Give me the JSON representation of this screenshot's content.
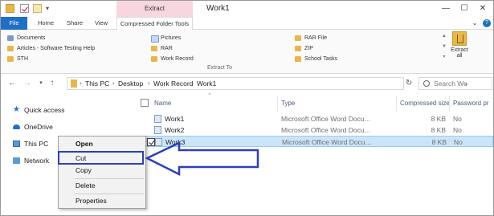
{
  "window": {
    "title": "Work1",
    "contextual_tab_label": "Extract",
    "minimize": "—",
    "maximize": "☐",
    "close": "✕"
  },
  "ribbon": {
    "tabs": [
      "File",
      "Home",
      "Share",
      "View",
      "Compressed Folder Tools"
    ],
    "destinations": [
      "Documents",
      "Articles - Software Testing Help",
      "STH",
      "Pictures",
      "RAR",
      "Work Record",
      "RAR File",
      "ZIP",
      "School Tasks"
    ],
    "group_label": "Extract To",
    "extract_all_label": "Extract all"
  },
  "address_bar": {
    "breadcrumbs": [
      "This PC",
      "Desktop",
      "Work Record",
      "Work1"
    ],
    "search_placeholder": "Search Wo"
  },
  "nav_pane": {
    "items": [
      "Quick access",
      "OneDrive",
      "This PC",
      "Network"
    ]
  },
  "columns": {
    "name": "Name",
    "type": "Type",
    "compressed_size": "Compressed size",
    "password": "Password pr"
  },
  "files": [
    {
      "name": "Work1",
      "type": "Microsoft Office Word Docu...",
      "size": "8 KB",
      "password": "No"
    },
    {
      "name": "Work2",
      "type": "Microsoft Office Word Docu...",
      "size": "8 KB",
      "password": "No"
    },
    {
      "name": "Work3",
      "type": "Microsoft Office Word Docu...",
      "size": "8 KB",
      "password": "No"
    }
  ],
  "context_menu": {
    "items": [
      "Open",
      "Cut",
      "Copy",
      "Delete",
      "Properties"
    ]
  },
  "colors": {
    "accent": "#1f6fc6",
    "selection": "#cce4f7",
    "annotation": "#2b3fbd",
    "contextual_tab": "#f7d6e0"
  }
}
